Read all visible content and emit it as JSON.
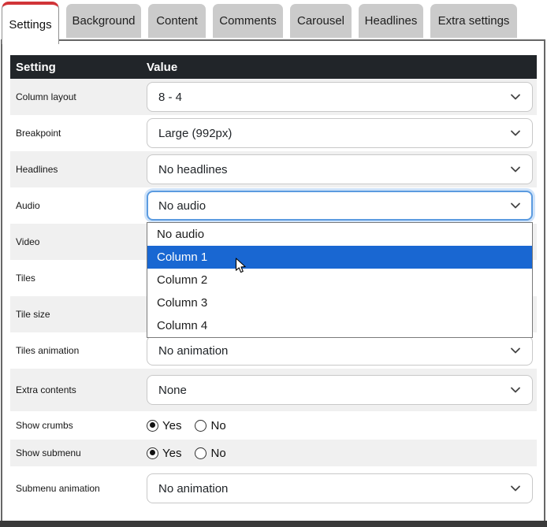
{
  "tabs": [
    {
      "label": "Settings",
      "active": true
    },
    {
      "label": "Background",
      "active": false
    },
    {
      "label": "Content",
      "active": false
    },
    {
      "label": "Comments",
      "active": false
    },
    {
      "label": "Carousel",
      "active": false
    },
    {
      "label": "Headlines",
      "active": false
    },
    {
      "label": "Extra settings",
      "active": false
    }
  ],
  "table": {
    "header": {
      "setting": "Setting",
      "value": "Value"
    },
    "rows": [
      {
        "label": "Column layout",
        "type": "select",
        "value": "8 - 4"
      },
      {
        "label": "Breakpoint",
        "type": "select",
        "value": "Large (992px)"
      },
      {
        "label": "Headlines",
        "type": "select",
        "value": "No headlines"
      },
      {
        "label": "Audio",
        "type": "select",
        "value": "No audio",
        "focused": true
      },
      {
        "label": "Video",
        "type": "select-hidden-behind-dropdown"
      },
      {
        "label": "Tiles",
        "type": "select-hidden-behind-dropdown"
      },
      {
        "label": "Tile size",
        "type": "select-hidden-behind-dropdown"
      },
      {
        "label": "Tiles animation",
        "type": "select",
        "value": "No animation"
      },
      {
        "label": "Extra contents",
        "type": "select",
        "value": "None"
      },
      {
        "label": "Show crumbs",
        "type": "radio",
        "options": [
          "Yes",
          "No"
        ],
        "selected": "Yes"
      },
      {
        "label": "Show submenu",
        "type": "radio",
        "options": [
          "Yes",
          "No"
        ],
        "selected": "Yes"
      },
      {
        "label": "Submenu animation",
        "type": "select",
        "value": "No animation"
      }
    ]
  },
  "dropdown": {
    "for": "Audio",
    "options": [
      "No audio",
      "Column 1",
      "Column 2",
      "Column 3",
      "Column 4"
    ],
    "highlighted": "Column 1"
  },
  "colors": {
    "accent_red": "#d13438",
    "header_bg": "#212529",
    "highlight_blue": "#1967d2",
    "focus_border_blue": "#5b9be0",
    "inactive_tab_gray": "#cbcbcb",
    "row_alt_gray": "#f0f0f0",
    "bottom_bar": "#3a3a3a"
  }
}
